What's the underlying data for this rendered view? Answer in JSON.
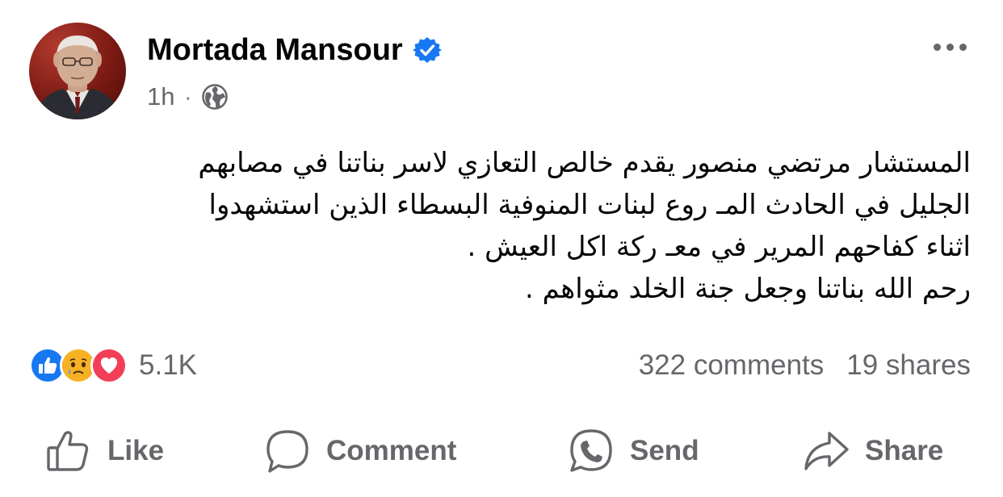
{
  "post": {
    "author": "Mortada Mansour",
    "time": "1h",
    "separator": "·",
    "audience_icon": "globe-icon",
    "verified_icon": "verified-badge-icon",
    "menu_icon": "more-options-icon",
    "text_lines": [
      "المستشار مرتضي منصور يقدم خالص التعازي لاسر بناتنا في مصابهم",
      "الجليل في الحادث المـ روع لبنات المنوفية البسطاء الذين استشهدوا",
      "اثناء كفاحهم المرير في معـ ركة اكل العيش .",
      "رحم الله بناتنا وجعل جنة الخلد مثواهم ."
    ]
  },
  "engagement": {
    "reaction_icons": [
      "like-reaction-icon",
      "sad-reaction-icon",
      "love-reaction-icon"
    ],
    "reaction_count": "5.1K",
    "comments": "322 comments",
    "shares": "19 shares"
  },
  "actions": {
    "like": "Like",
    "comment": "Comment",
    "send": "Send",
    "share": "Share"
  },
  "colors": {
    "text_primary": "#050505",
    "text_secondary": "#65676b",
    "verified_blue": "#1877f2",
    "like_blue": "#1877f2",
    "love_red": "#f33e58",
    "sad_yellow": "#f7b125"
  }
}
